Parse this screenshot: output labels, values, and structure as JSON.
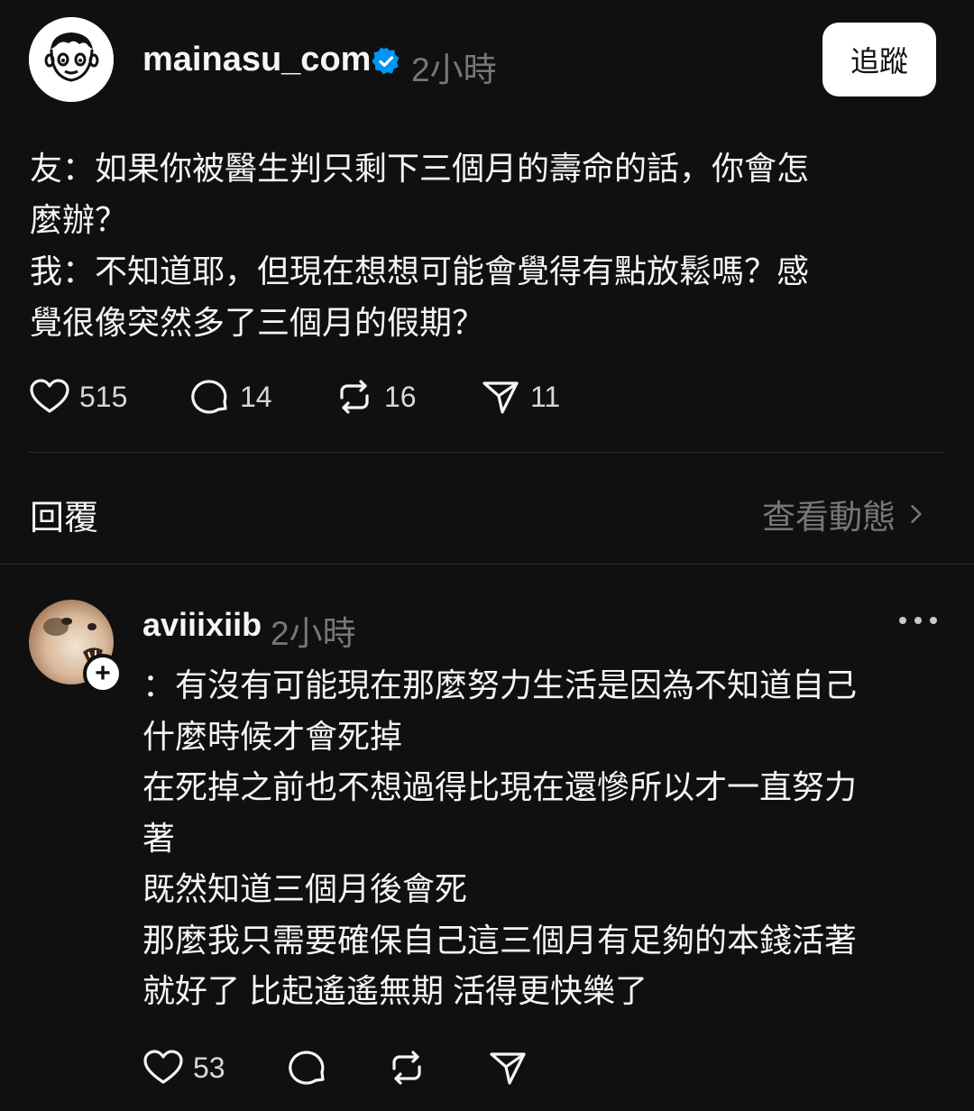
{
  "post": {
    "username": "mainasu_com",
    "time": "2小時",
    "follow_label": "追蹤",
    "text_lines": [
      "友：如果你被醫生判只剩下三個月的壽命的話，你會怎",
      "麼辦？",
      "我：不知道耶，但現在想想可能會覺得有點放鬆嗎？感",
      "覺很像突然多了三個月的假期？"
    ],
    "actions": {
      "likes": "515",
      "comments": "14",
      "reposts": "16",
      "shares": "11"
    },
    "icons": [
      "heart-icon",
      "comment-icon",
      "repost-icon",
      "share-icon",
      "verified-badge-icon"
    ]
  },
  "replies_section": {
    "label": "回覆",
    "view_activity_label": "查看動態"
  },
  "reply": {
    "username": "aviiixiib",
    "time": "2小時",
    "text_lines": [
      "：有沒有可能現在那麼努力生活是因為不知道自己",
      "什麼時候才會死掉",
      "在死掉之前也不想過得比現在還慘所以才一直努力",
      "著",
      "既然知道三個月後會死",
      "那麼我只需要確保自己這三個月有足夠的本錢活著",
      "就好了 比起遙遙無期 活得更快樂了"
    ],
    "actions": {
      "likes": "53"
    }
  },
  "colors": {
    "background": "#101010",
    "text": "#f3f5f7",
    "muted": "#777777",
    "verified": "#0095f6",
    "divider": "#2e2e2e"
  }
}
